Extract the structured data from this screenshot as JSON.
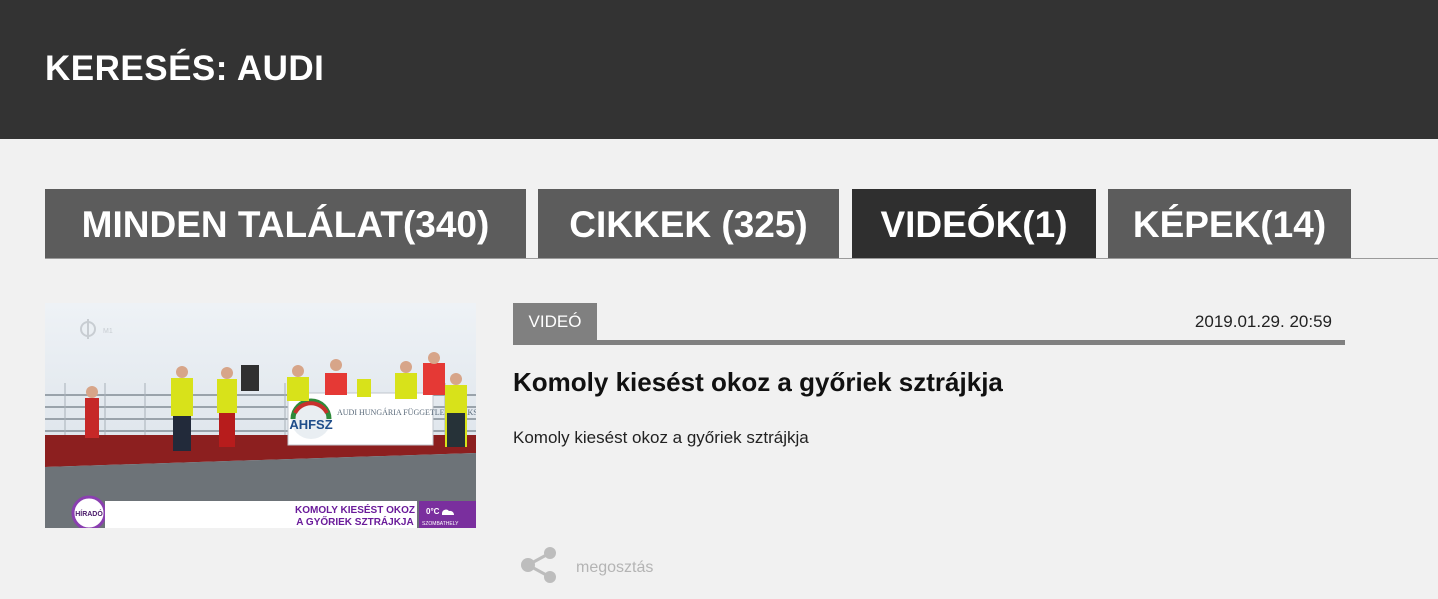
{
  "header": {
    "title": "KERESÉS: AUDI"
  },
  "tabs": [
    {
      "label": "MINDEN TALÁLAT(340)",
      "active": false
    },
    {
      "label": "CIKKEK (325)",
      "active": false
    },
    {
      "label": "VIDEÓK(1)",
      "active": true
    },
    {
      "label": "KÉPEK(14)",
      "active": false
    }
  ],
  "result": {
    "category": "VIDEÓ",
    "date": "2019.01.29. 20:59",
    "title": "Komoly kiesést okoz a győriek sztrájkja",
    "lead": "Komoly kiesést okoz a győriek sztrájkja",
    "thumbnail": {
      "banner_text": "AUDI HUNGÁRIA FÜGGETLEN SZAKSZERVEZET",
      "banner_logo": "AHFSZ",
      "caption_line1": "KOMOLY KIESÉST OKOZ",
      "caption_line2": "A GYŐRIEK SZTRÁJKJA",
      "channel_badge": "HÍRADÓ",
      "weather_temp": "0°C",
      "weather_city": "SZOMBATHELY",
      "channel_logo": "M1"
    }
  },
  "share": {
    "label": "megosztás",
    "icon": "share-icon"
  },
  "colors": {
    "header_bg": "#333333",
    "tab_bg": "#5c5c5c",
    "tab_active_bg": "#2f2f2f",
    "badge_bg": "#808080",
    "caption_purple": "#7a2f9e"
  }
}
